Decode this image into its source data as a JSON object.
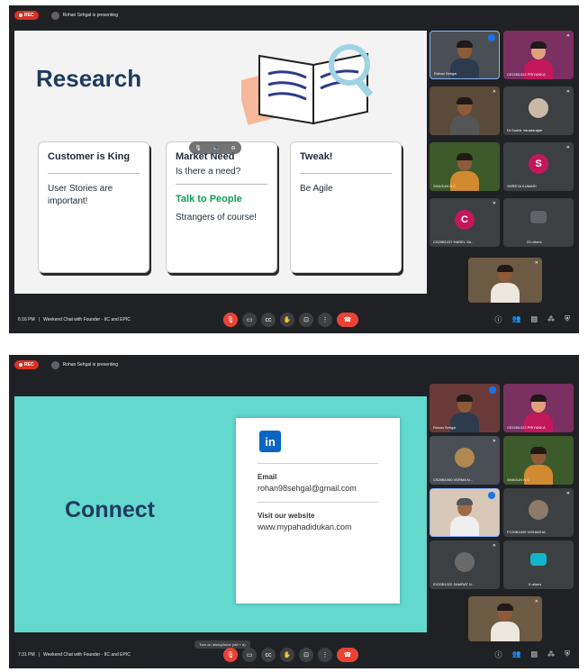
{
  "shot1": {
    "rec_label": "REC",
    "presenting": "Rohan Sehgal is presenting",
    "slide": {
      "title": "Research",
      "cards": [
        {
          "heading": "Customer is King",
          "body": "User Stories are important!"
        },
        {
          "heading": "Market Need",
          "question": "Is there a need?",
          "subheading": "Talk to People",
          "body": "Strangers of course!"
        },
        {
          "heading": "Tweak!",
          "body": "Be Agile"
        }
      ]
    },
    "participants": [
      {
        "name": "Rohan Sehgal",
        "type": "video"
      },
      {
        "name": "CE21B1022 PRIYANKA",
        "type": "video"
      },
      {
        "name": "",
        "type": "video"
      },
      {
        "name": "Dr.Sudhir Varadarajan",
        "type": "video"
      },
      {
        "name": "SHAGUN N C",
        "type": "video"
      },
      {
        "name": "SHREYA KUMARI",
        "type": "avatar",
        "initial": "S",
        "color": "#c2185b"
      },
      {
        "name": "CS20B1037 HAREL SA...",
        "type": "avatar",
        "initial": "C",
        "color": "#c2185b"
      },
      {
        "name": "23 others",
        "type": "others"
      }
    ],
    "footer": {
      "time": "6:16 PM",
      "separator": "|",
      "meeting": "Weekend Chat with Founder - IIC and EPIC"
    }
  },
  "shot2": {
    "rec_label": "REC",
    "presenting": "Rohan Sehgal is presenting",
    "slide": {
      "title": "Connect",
      "linkedin": "in",
      "email_label": "Email",
      "email": "rohan98sehgal@gmail.com",
      "website_label": "Visit our website",
      "website": "www.mypahadidukan.com"
    },
    "participants": [
      {
        "name": "Rohan Sehgal",
        "type": "video"
      },
      {
        "name": "CE21B1022 PRIYANKA",
        "type": "video"
      },
      {
        "name": "CS20B1060 VERMA N...",
        "type": "video"
      },
      {
        "name": "SHAGUN N C",
        "type": "video"
      },
      {
        "name": "",
        "type": "video"
      },
      {
        "name": "FC20B1039 VISHAKHA",
        "type": "video"
      },
      {
        "name": "EV20B1022 SAMRAT N...",
        "type": "video"
      },
      {
        "name": "5 others",
        "type": "others"
      }
    ],
    "tooltip": "Turn on microphone (ctrl + d)",
    "footer": {
      "time": "7:31 PM",
      "separator": "|",
      "meeting": "Weekend Chat with Founder - IIC and EPIC"
    }
  },
  "icons": {
    "mic": "mic-off-icon",
    "camera": "camera-icon",
    "captions": "captions-icon",
    "hand": "raise-hand-icon",
    "present": "present-icon",
    "more": "more-options-icon",
    "leave": "leave-call-icon",
    "info": "info-icon",
    "people": "people-icon",
    "chat": "chat-icon",
    "activities": "activities-icon",
    "host": "host-controls-icon"
  },
  "colors": {
    "meet_bg": "#202124",
    "red": "#ea4335",
    "teal_slide": "#62d8cf",
    "title_navy": "#1e3a5f",
    "linkedin_blue": "#0a66c2"
  }
}
